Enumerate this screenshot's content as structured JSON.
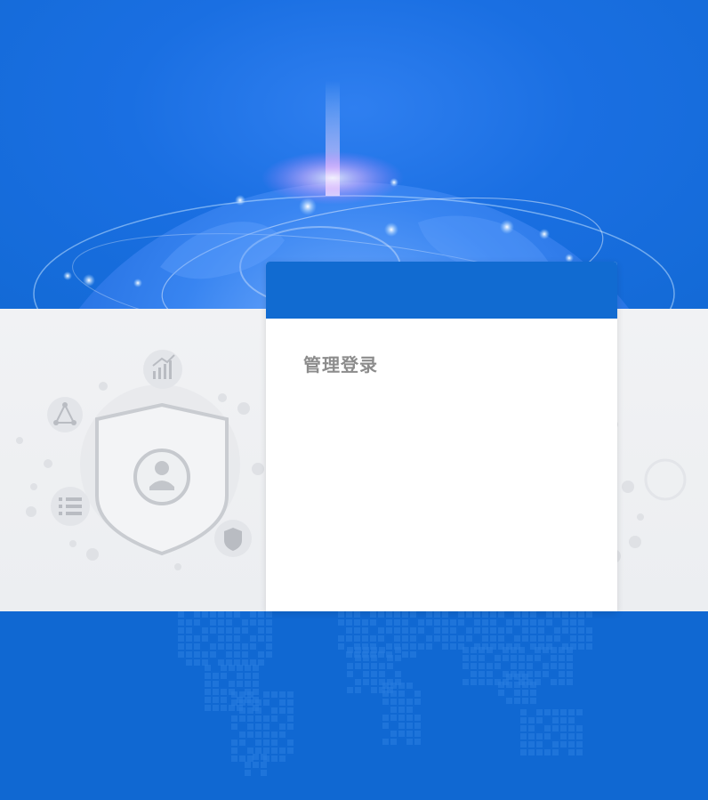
{
  "login": {
    "title": "管理登录"
  },
  "colors": {
    "primary_blue": "#116bd1",
    "band_gray": "#eff0f2",
    "title_gray": "#8c8c8c",
    "card_bg": "#ffffff"
  },
  "icons": {
    "shield": "shield-user-icon",
    "chart": "trend-chart-icon",
    "network": "network-triangle-icon",
    "list": "list-icon",
    "security": "small-shield-icon",
    "globe": "globe-icon",
    "world_map": "dotted-world-map"
  }
}
